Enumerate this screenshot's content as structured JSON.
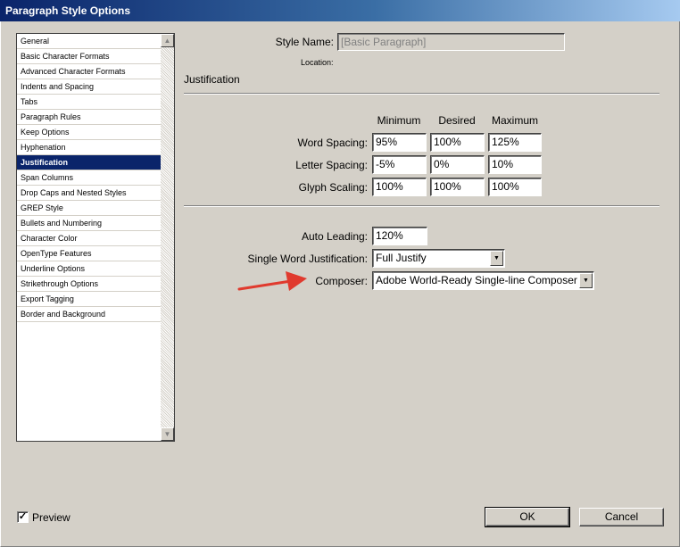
{
  "window": {
    "title": "Paragraph Style Options"
  },
  "sidebar": {
    "items": [
      {
        "label": "General"
      },
      {
        "label": "Basic Character Formats"
      },
      {
        "label": "Advanced Character Formats"
      },
      {
        "label": "Indents and Spacing"
      },
      {
        "label": "Tabs"
      },
      {
        "label": "Paragraph Rules"
      },
      {
        "label": "Keep Options"
      },
      {
        "label": "Hyphenation"
      },
      {
        "label": "Justification",
        "selected": true
      },
      {
        "label": "Span Columns"
      },
      {
        "label": "Drop Caps and Nested Styles"
      },
      {
        "label": "GREP Style"
      },
      {
        "label": "Bullets and Numbering"
      },
      {
        "label": "Character Color"
      },
      {
        "label": "OpenType Features"
      },
      {
        "label": "Underline Options"
      },
      {
        "label": "Strikethrough Options"
      },
      {
        "label": "Export Tagging"
      },
      {
        "label": "Border and Background"
      }
    ],
    "scroll_up_icon": "up-arrow-icon",
    "scroll_down_icon": "down-arrow-icon"
  },
  "header": {
    "style_name_label": "Style Name:",
    "style_name_value": "[Basic Paragraph]",
    "location_label": "Location:"
  },
  "section": {
    "title": "Justification"
  },
  "spacing": {
    "columns": [
      "Minimum",
      "Desired",
      "Maximum"
    ],
    "rows": [
      {
        "label": "Word Spacing:",
        "values": [
          "95%",
          "100%",
          "125%"
        ]
      },
      {
        "label": "Letter Spacing:",
        "values": [
          "-5%",
          "0%",
          "10%"
        ]
      },
      {
        "label": "Glyph Scaling:",
        "values": [
          "100%",
          "100%",
          "100%"
        ]
      }
    ]
  },
  "options": {
    "auto_leading_label": "Auto Leading:",
    "auto_leading_value": "120%",
    "single_word_label": "Single Word Justification:",
    "single_word_value": "Full Justify",
    "composer_label": "Composer:",
    "composer_value": "Adobe World-Ready Single-line Composer"
  },
  "annotation": {
    "arrow_color": "#e03a2e"
  },
  "footer": {
    "preview_label": "Preview",
    "preview_checked": true,
    "ok_label": "OK",
    "cancel_label": "Cancel"
  },
  "colors": {
    "dialog_bg": "#d4d0c8",
    "selection_bg": "#0a246a",
    "title_gradient_start": "#0a246a",
    "title_gradient_end": "#a6caf0"
  }
}
